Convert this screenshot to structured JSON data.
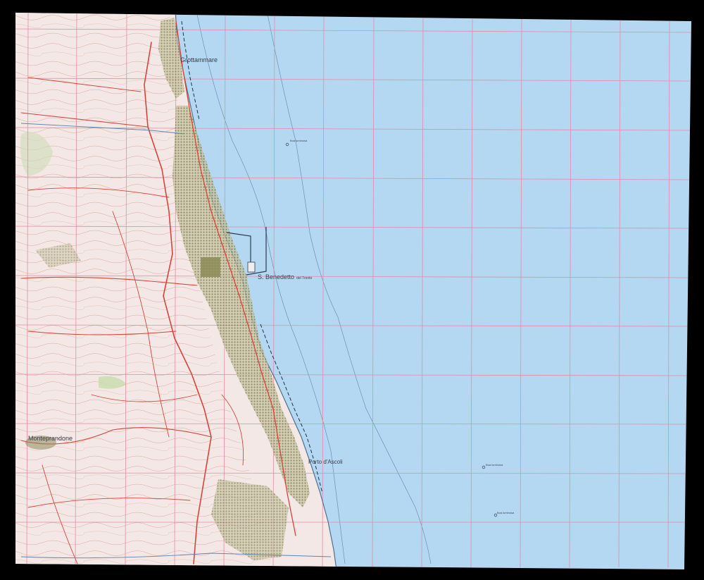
{
  "map": {
    "colors": {
      "frame": "#000000",
      "sea": "#b4d8f2",
      "land": "#f3e6e4",
      "grid": "#e48aa8",
      "contour": "#d99a7f",
      "road": "#d6443a",
      "urban": "#7b7f5a",
      "bathymetry": "#6e8fb0"
    },
    "places": {
      "grottammare": "Grottammare",
      "san_benedetto": "S. Benedetto",
      "san_benedetto_suffix": "del Tronto",
      "monteprandone": "Monteprandone",
      "porto_ascoli": "Porto d'Ascoli"
    },
    "sea_marks": {
      "mark1": "Boa luminosa",
      "mark2": "Boa luminosa",
      "mark3": "Boa luminosa"
    }
  }
}
